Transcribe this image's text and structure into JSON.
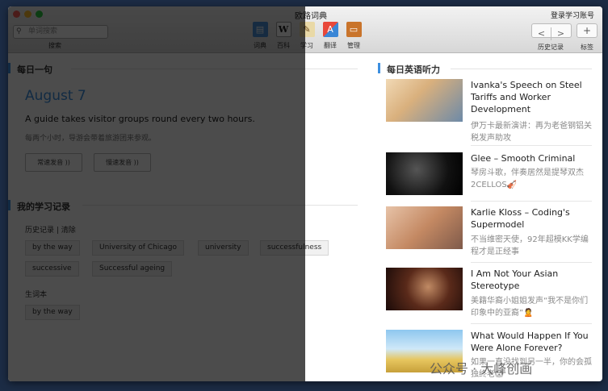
{
  "window": {
    "title": "欧路词典"
  },
  "toolbar": {
    "search_placeholder": "单词搜索",
    "search_label": "搜索",
    "tools": [
      {
        "label": "词典",
        "icon": "dictionary-icon"
      },
      {
        "label": "百科",
        "icon": "wikipedia-icon"
      },
      {
        "label": "学习",
        "icon": "study-icon"
      },
      {
        "label": "翻译",
        "icon": "translate-icon"
      },
      {
        "label": "管理",
        "icon": "manage-icon"
      }
    ],
    "login": "登录学习账号",
    "back": "<",
    "forward": ">",
    "plus": "+",
    "history_label": "历史记录",
    "bookmark_label": "标签"
  },
  "daily": {
    "heading": "每日一句",
    "date": "August 7",
    "sentence": "A guide takes visitor groups round every two hours.",
    "translation": "每两个小时，导游会带着旅游团来参观。",
    "normal_btn": "常速发音",
    "slow_btn": "慢速发音"
  },
  "records": {
    "heading": "我的学习记录",
    "history_label": "历史记录 | 清除",
    "history": [
      "by the way",
      "University of Chicago",
      "university",
      "successfulness",
      "successive",
      "Successful ageing"
    ],
    "vocab_label": "生词本",
    "vocab": [
      "by the way"
    ]
  },
  "listening": {
    "heading": "每日英语听力",
    "items": [
      {
        "title": "Ivanka's Speech on Steel Tariffs and Worker Development",
        "desc": "伊万卡最新演讲：再为老爸钢铝关税发声助攻"
      },
      {
        "title": "Glee – Smooth Criminal",
        "desc": "琴房斗歌，伴奏居然是提琴双杰2CELLOS🎻"
      },
      {
        "title": "Karlie Kloss – Coding's Supermodel",
        "desc": "不当维密天使，92年超模KK学编程才是正经事"
      },
      {
        "title": "I Am Not Your Asian Stereotype",
        "desc": "美籍华裔小姐姐发声“我不是你们印象中的亚裔”🙎"
      },
      {
        "title": "What Would Happen If You Were Alone Forever?",
        "desc": "如果一直没找到另一半，你的会孤独终老😱"
      }
    ]
  },
  "watermark": "公众号 · 大峰创画",
  "colors": {
    "accent": "#3d8fe0",
    "close": "#fc5f57",
    "minimize": "#fdbc2e",
    "zoom": "#28c840"
  }
}
